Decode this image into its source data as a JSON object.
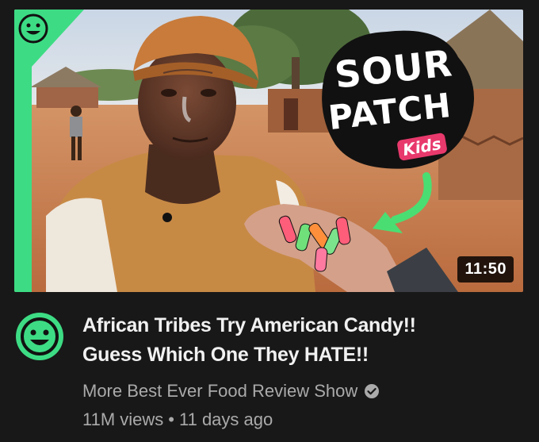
{
  "video": {
    "duration": "11:50",
    "thumbnail_text": {
      "line1": "SOUR",
      "line2": "PATCH",
      "line3": "Kids"
    },
    "title_line1": "African Tribes Try American Candy!!",
    "title_line2": "Guess Which One They HATE!!",
    "channel_name": "More Best Ever Food Review Show",
    "views": "11M views",
    "separator": "•",
    "age": "11 days ago"
  },
  "colors": {
    "background": "#181818",
    "accent_green": "#3ddc84",
    "title_text": "#f1f1f1",
    "meta_text": "#aaaaaa",
    "candy_pink": "#e8396c"
  },
  "icons": {
    "avatar": "smiley-face-icon",
    "verified": "check-circle-icon",
    "thumbnail_badge": "smiley-face-icon"
  }
}
